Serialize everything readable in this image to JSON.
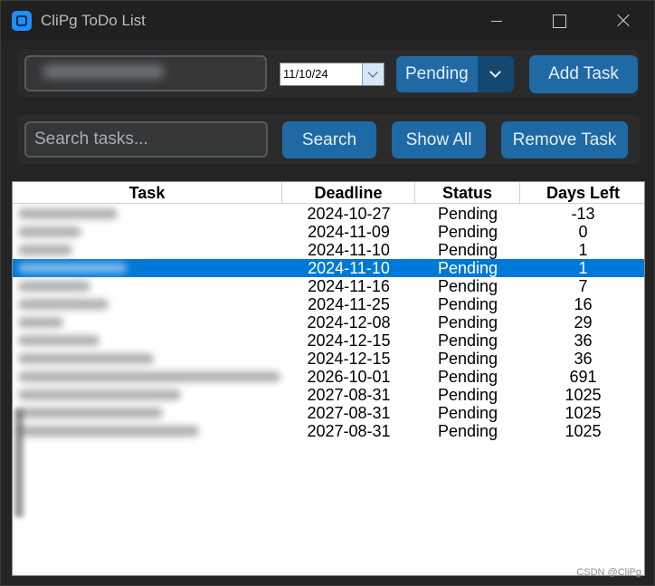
{
  "window": {
    "title": "CliPg ToDo List"
  },
  "top_bar": {
    "task_input_value": "",
    "date_value": "11/10/24",
    "status_selected": "Pending",
    "add_button_label": "Add Task"
  },
  "search_bar": {
    "placeholder": "Search tasks...",
    "search_button_label": "Search",
    "show_all_button_label": "Show All",
    "remove_button_label": "Remove Task"
  },
  "table": {
    "columns": [
      "Task",
      "Deadline",
      "Status",
      "Days Left"
    ],
    "selected_row_index": 3,
    "rows": [
      {
        "task": "",
        "deadline": "2024-10-27",
        "status": "Pending",
        "days_left": "-13"
      },
      {
        "task": "",
        "deadline": "2024-11-09",
        "status": "Pending",
        "days_left": "0"
      },
      {
        "task": "",
        "deadline": "2024-11-10",
        "status": "Pending",
        "days_left": "1"
      },
      {
        "task": "",
        "deadline": "2024-11-10",
        "status": "Pending",
        "days_left": "1"
      },
      {
        "task": "",
        "deadline": "2024-11-16",
        "status": "Pending",
        "days_left": "7"
      },
      {
        "task": "",
        "deadline": "2024-11-25",
        "status": "Pending",
        "days_left": "16"
      },
      {
        "task": "",
        "deadline": "2024-12-08",
        "status": "Pending",
        "days_left": "29"
      },
      {
        "task": "",
        "deadline": "2024-12-15",
        "status": "Pending",
        "days_left": "36"
      },
      {
        "task": "",
        "deadline": "2024-12-15",
        "status": "Pending",
        "days_left": "36"
      },
      {
        "task": "",
        "deadline": "2026-10-01",
        "status": "Pending",
        "days_left": "691"
      },
      {
        "task": "",
        "deadline": "2027-08-31",
        "status": "Pending",
        "days_left": "1025"
      },
      {
        "task": "",
        "deadline": "2027-08-31",
        "status": "Pending",
        "days_left": "1025"
      },
      {
        "task": "",
        "deadline": "2027-08-31",
        "status": "Pending",
        "days_left": "1025"
      }
    ]
  },
  "watermark": "CSDN @CliPg",
  "colors": {
    "accent": "#1f6aa5",
    "accent_dark": "#144870",
    "selection": "#0078d7",
    "window_bg": "#242424"
  }
}
